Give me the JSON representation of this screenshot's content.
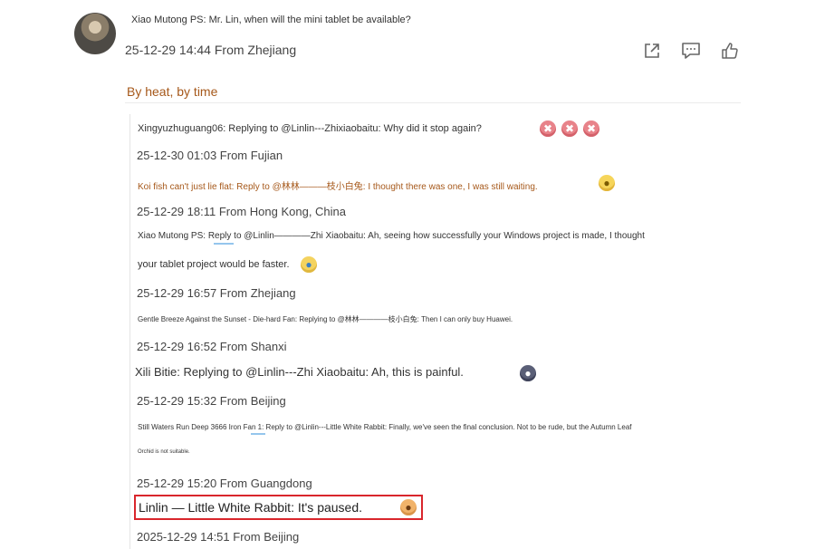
{
  "post": {
    "text": "Xiao Mutong PS: Mr. Lin, when will the mini tablet be available?",
    "meta": "25-12-29 14:44 From Zhejiang"
  },
  "actions": [
    "share-icon",
    "comment-icon",
    "like-icon"
  ],
  "sort_label": "By heat, by time",
  "replies": [
    {
      "text": "Xingyuzhuguang06: Replying to @Linlin---Zhixiaobaitu: Why did it stop again?",
      "meta": "25-12-30 01:03 From Fujian"
    },
    {
      "text": "Koi fish can't just lie flat: Reply to @林林———枝小白兔: I thought there was one, I was still waiting.",
      "meta": "25-12-29 18:11 From Hong Kong, China"
    },
    {
      "text": "Xiao Mutong PS: Reply to @Linlin————Zhi Xiaobaitu: Ah, seeing how successfully your Windows project is made, I thought",
      "text2": "your tablet project would be faster.",
      "meta": "25-12-29 16:57 From Zhejiang"
    },
    {
      "text": "Gentle Breeze Against the Sunset - Die-hard Fan: Replying to @林林————枝小白兔: Then I can only buy Huawei.",
      "meta": "25-12-29 16:52 From Shanxi"
    },
    {
      "text": "Xili Bitie: Replying to @Linlin---Zhi Xiaobaitu: Ah, this is painful.",
      "meta": "25-12-29 15:32 From Beijing"
    },
    {
      "text": "Still Waters Run Deep 3666 Iron Fan 1: Reply to @Linlin---Little White Rabbit: Finally, we've seen the final conclusion. Not to be rude, but the Autumn Leaf",
      "text2": "Orchid is not suitable.",
      "meta": "25-12-29 15:20 From Guangdong"
    }
  ],
  "highlighted_reply": {
    "text": "Linlin — Little White Rabbit: It's paused.",
    "meta": "2025-12-29 14:51 From Beijing"
  },
  "emoji": [
    "angry-emoji",
    "cool-emoji",
    "crying-emoji",
    "sad-emoji",
    "dog-emoji"
  ],
  "colors": {
    "sort_label": "#a6581a",
    "highlight_border": "#d9262c",
    "koi_reply": "#a6581a"
  }
}
